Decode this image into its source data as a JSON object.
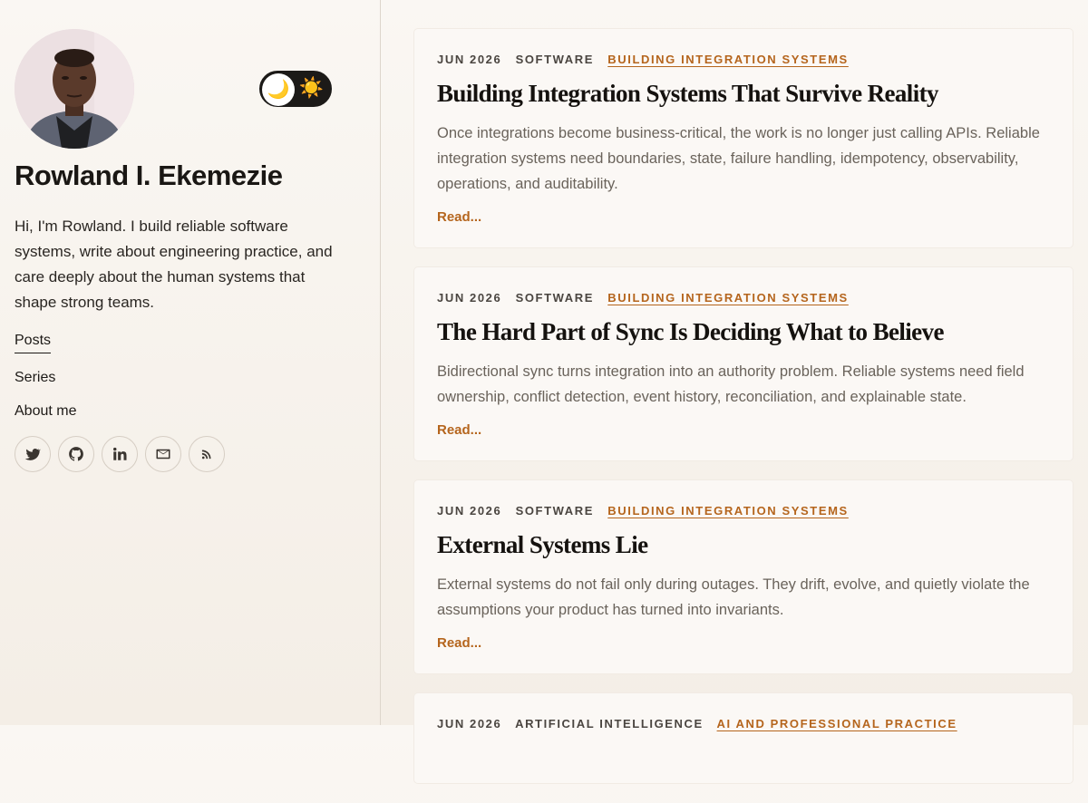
{
  "profile": {
    "name": "Rowland I. Ekemezie",
    "bio": "Hi, I'm Rowland. I build reliable software systems, write about engineering practice, and care deeply about the human systems that shape strong teams.",
    "theme_toggle": {
      "moon": "🌙",
      "sun": "☀️"
    }
  },
  "nav": {
    "items": [
      {
        "label": "Posts"
      },
      {
        "label": "Series"
      },
      {
        "label": "About me"
      }
    ]
  },
  "socials": [
    "twitter-icon",
    "github-icon",
    "linkedin-icon",
    "mail-icon",
    "rss-icon"
  ],
  "colors": {
    "accent": "#b5651d",
    "toggle_bg": "#1c1a18"
  },
  "posts": [
    {
      "date": "JUN 2026",
      "category": "SOFTWARE",
      "series": "BUILDING INTEGRATION SYSTEMS",
      "title": "Building Integration Systems That Survive Reality",
      "excerpt": "Once integrations become business-critical, the work is no longer just calling APIs. Reliable integration systems need boundaries, state, failure handling, idempotency, observability, operations, and auditability.",
      "read": "Read..."
    },
    {
      "date": "JUN 2026",
      "category": "SOFTWARE",
      "series": "BUILDING INTEGRATION SYSTEMS",
      "title": "The Hard Part of Sync Is Deciding What to Believe",
      "excerpt": "Bidirectional sync turns integration into an authority problem. Reliable systems need field ownership, conflict detection, event history, reconciliation, and explainable state.",
      "read": "Read..."
    },
    {
      "date": "JUN 2026",
      "category": "SOFTWARE",
      "series": "BUILDING INTEGRATION SYSTEMS",
      "title": "External Systems Lie",
      "excerpt": "External systems do not fail only during outages. They drift, evolve, and quietly violate the assumptions your product has turned into invariants.",
      "read": "Read..."
    },
    {
      "date": "JUN 2026",
      "category": "ARTIFICIAL INTELLIGENCE",
      "series": "AI AND PROFESSIONAL PRACTICE",
      "title": "",
      "excerpt": "",
      "read": ""
    }
  ]
}
